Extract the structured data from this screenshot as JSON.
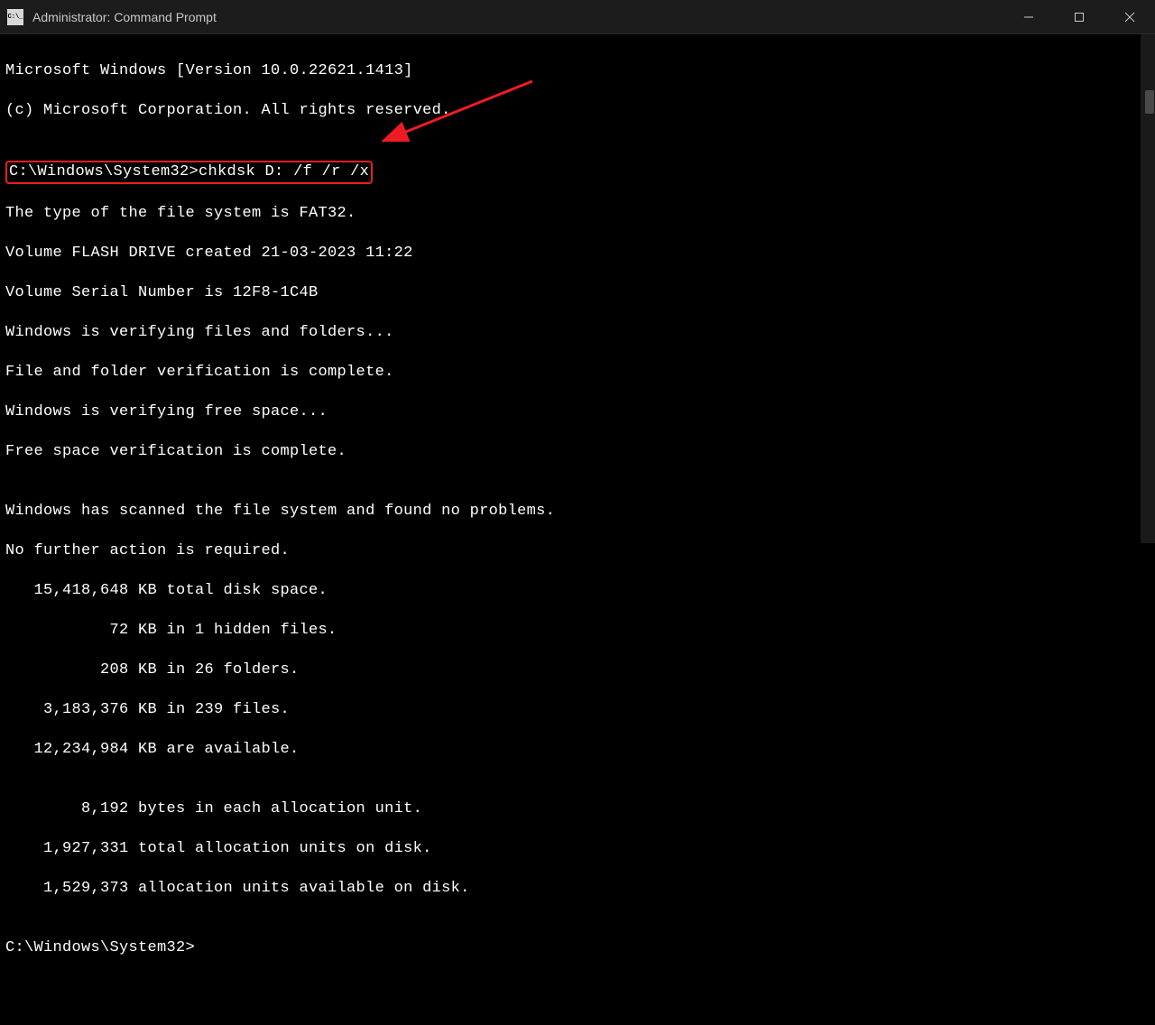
{
  "window": {
    "title": "Administrator: Command Prompt"
  },
  "terminal": {
    "line1": "Microsoft Windows [Version 10.0.22621.1413]",
    "line2": "(c) Microsoft Corporation. All rights reserved.",
    "line3": "",
    "prompt1": "C:\\Windows\\System32>",
    "command1": "chkdsk D: /f /r /x",
    "line4": "The type of the file system is FAT32.",
    "line5": "Volume FLASH DRIVE created 21-03-2023 11:22",
    "line6": "Volume Serial Number is 12F8-1C4B",
    "line7": "Windows is verifying files and folders...",
    "line8": "File and folder verification is complete.",
    "line9": "Windows is verifying free space...",
    "line10": "Free space verification is complete.",
    "line11": "",
    "line12": "Windows has scanned the file system and found no problems.",
    "line13": "No further action is required.",
    "line14": "   15,418,648 KB total disk space.",
    "line15": "           72 KB in 1 hidden files.",
    "line16": "          208 KB in 26 folders.",
    "line17": "    3,183,376 KB in 239 files.",
    "line18": "   12,234,984 KB are available.",
    "line19": "",
    "line20": "        8,192 bytes in each allocation unit.",
    "line21": "    1,927,331 total allocation units on disk.",
    "line22": "    1,529,373 allocation units available on disk.",
    "line23": "",
    "prompt2": "C:\\Windows\\System32>"
  },
  "annotation": {
    "arrow_color": "#ed1c24",
    "highlight_color": "#ed1c24"
  }
}
